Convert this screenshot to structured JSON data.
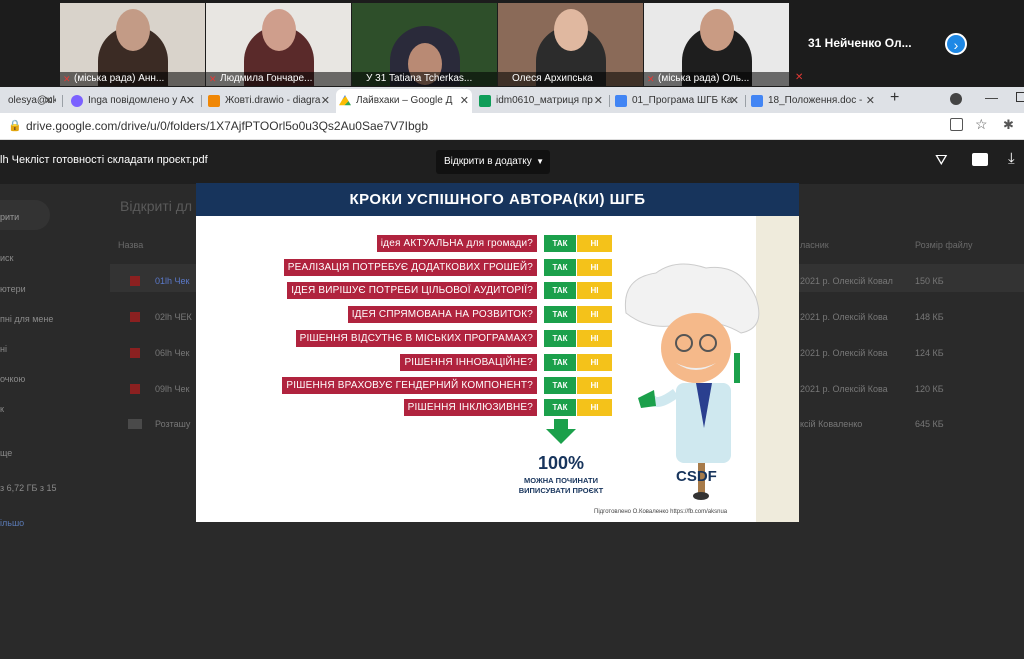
{
  "video": {
    "participants": [
      {
        "name": "(міська рада) Анн..."
      },
      {
        "name": "Людмила Гончаре..."
      },
      {
        "name": "У 31 Tatiana Tcherkas..."
      },
      {
        "name": "Олеся Архипська"
      },
      {
        "name": "(міська рада) Оль..."
      }
    ],
    "more_label": "31 Нейченко Ол..."
  },
  "tabs": [
    {
      "label": "olesya@uk",
      "icon_color": "#ea4335"
    },
    {
      "label": "Inga повідомлено у А",
      "icon_color": "#7b61ff"
    },
    {
      "label": "Жовті.drawio - diagra",
      "icon_color": "#f08705"
    },
    {
      "label": "Лайвхаки – Google Д",
      "icon_color": "#34a853",
      "active": true
    },
    {
      "label": "idm0610_матриця пр",
      "icon_color": "#0f9d58"
    },
    {
      "label": "01_Програма ШГБ Ка",
      "icon_color": "#4285f4"
    },
    {
      "label": "18_Положення.doc -",
      "icon_color": "#4285f4"
    }
  ],
  "address": {
    "url": "drive.google.com/drive/u/0/folders/1X7AjfPTOOrl5o0u3Qs2Au0Sae7V7Ibgb"
  },
  "viewer": {
    "file_title": "lh Чекліст готовності складати проєкт.pdf",
    "open_with_label": "Відкрити в додатку"
  },
  "drive_bg": {
    "section_title": "Відкриті дл",
    "col_name": "Назва",
    "col_owner": "ласник",
    "col_size": "Розмір файлу",
    "sidebar": [
      "рити",
      "иск",
      "ютери",
      "пні для мене",
      "ні",
      "очкою",
      "к",
      "ще",
      "з 6,72 ГБ з 15",
      "ільшо"
    ],
    "rows": [
      {
        "name": "01lh Чек",
        "date": "2021 р. Олексій Ковал",
        "size": "150 КБ"
      },
      {
        "name": "02lh ЧЕК",
        "date": "2021 р. Олексій Кова",
        "size": "148 КБ"
      },
      {
        "name": "06lh Чек",
        "date": "2021 р. Олексій Кова",
        "size": "124 КБ"
      },
      {
        "name": "09lh Чек",
        "date": "2021 р. Олексій Кова",
        "size": "120 КБ"
      },
      {
        "name": "Розташу",
        "date": "ксій Коваленко",
        "size": "645 КБ"
      }
    ]
  },
  "slide": {
    "title": "КРОКИ УСПІШНОГО АВТОРА(КИ) ШГБ",
    "yes": "ТАК",
    "no": "НІ",
    "questions": [
      "ідея АКТУАЛЬНА для громади?",
      "РЕАЛІЗАЦІЯ ПОТРЕБУЄ ДОДАТКОВИХ ГРОШЕЙ?",
      "ІДЕЯ ВИРІШУЄ ПОТРЕБИ ЦІЛЬОВОЇ АУДИТОРІЇ?",
      "ІДЕЯ СПРЯМОВАНА НА РОЗВИТОК?",
      "РІШЕННЯ ВІДСУТНЄ В МІСЬКИХ ПРОГРАМАХ?",
      "РІШЕННЯ ІННОВАЦІЙНЕ?",
      "РІШЕННЯ ВРАХОВУЄ ГЕНДЕРНИЙ КОМПОНЕНТ?",
      "РІШЕННЯ ІНКЛЮЗИВНЕ?"
    ],
    "percent": "100%",
    "percent_sub": "МОЖНА ПОЧИНАТИ ВИПИСУВАТИ ПРОЄКТ",
    "logo": "CSDF",
    "credit": "Підготовлено О.Коваленко https://fb.com/aksnua"
  }
}
